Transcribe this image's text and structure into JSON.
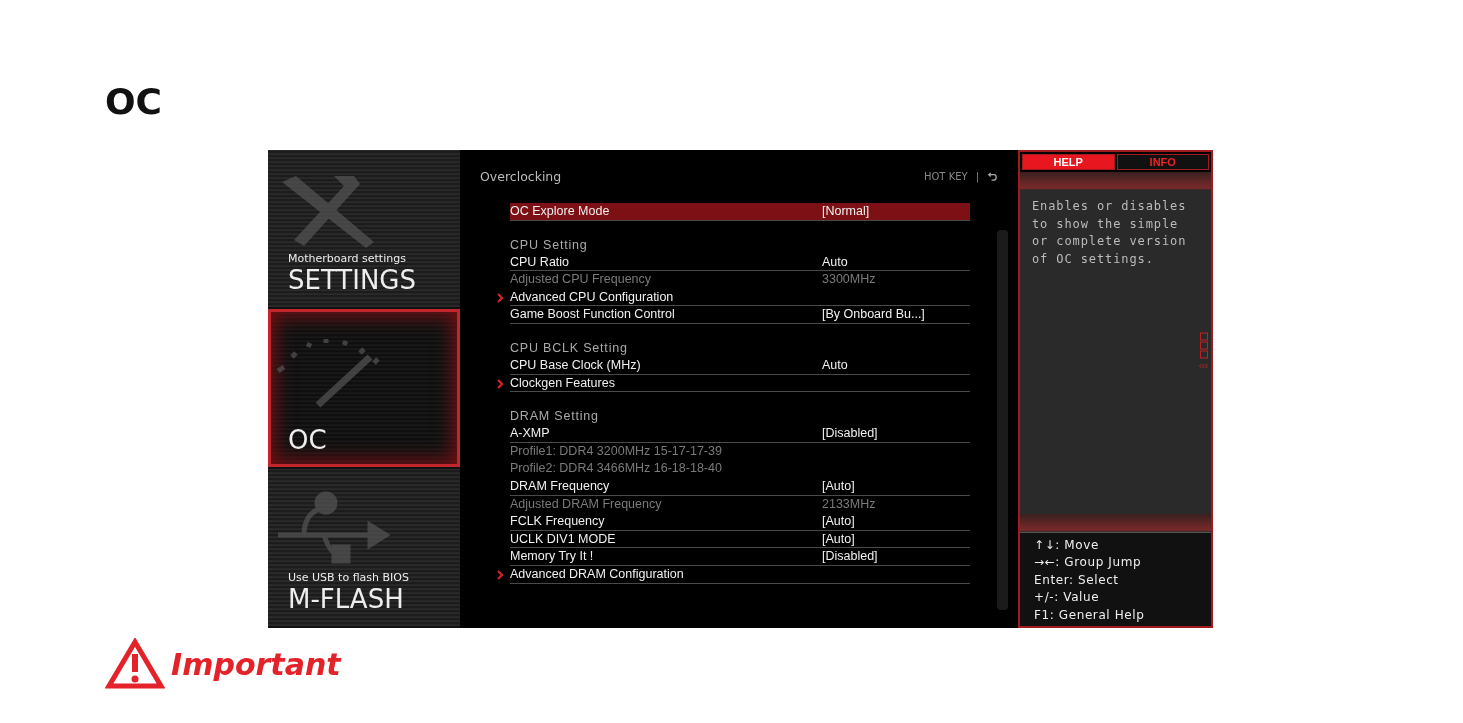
{
  "page_title": "OC",
  "bios": {
    "sidebar": [
      {
        "subtitle": "Motherboard settings",
        "title": "SETTINGS",
        "selected": false
      },
      {
        "title": "OC",
        "selected": true
      },
      {
        "subtitle": "Use USB to flash BIOS",
        "title": "M-FLASH",
        "selected": false
      }
    ],
    "header": {
      "title": "Overclocking",
      "hotkey": "HOT KEY",
      "separator": "|"
    },
    "items": [
      {
        "kind": "option",
        "label": "OC Explore Mode",
        "value": "[Normal]",
        "selected": true
      },
      {
        "kind": "header",
        "label": "CPU Setting"
      },
      {
        "kind": "option",
        "label": "CPU Ratio",
        "value": "Auto",
        "selected": false
      },
      {
        "kind": "readonly",
        "label": "Adjusted CPU Frequency",
        "value": "3300MHz",
        "selected": false
      },
      {
        "kind": "submenu",
        "label": "Advanced CPU Configuration",
        "selected": false
      },
      {
        "kind": "option",
        "label": "Game Boost Function Control",
        "value": "[By Onboard Bu...]",
        "selected": false
      },
      {
        "kind": "header",
        "label": "CPU BCLK Setting"
      },
      {
        "kind": "option",
        "label": "CPU Base Clock (MHz)",
        "value": "Auto",
        "selected": false
      },
      {
        "kind": "submenu",
        "label": "Clockgen Features",
        "selected": false
      },
      {
        "kind": "header",
        "label": "DRAM Setting"
      },
      {
        "kind": "option",
        "label": "A-XMP",
        "value": "[Disabled]",
        "selected": false
      },
      {
        "kind": "readonly",
        "label": "Profile1: DDR4 3200MHz 15-17-17-39",
        "selected": false
      },
      {
        "kind": "readonly",
        "label": "Profile2: DDR4 3466MHz 16-18-18-40",
        "selected": false
      },
      {
        "kind": "option",
        "label": "DRAM Frequency",
        "value": "[Auto]",
        "selected": false
      },
      {
        "kind": "readonly",
        "label": "Adjusted DRAM Frequency",
        "value": "2133MHz",
        "selected": false
      },
      {
        "kind": "option",
        "label": "FCLK Frequency",
        "value": "[Auto]",
        "selected": false
      },
      {
        "kind": "option",
        "label": "UCLK DIV1 MODE",
        "value": "[Auto]",
        "selected": false
      },
      {
        "kind": "option",
        "label": "Memory Try It !",
        "value": "[Disabled]",
        "selected": false
      },
      {
        "kind": "submenu",
        "label": "Advanced DRAM Configuration",
        "selected": false
      }
    ],
    "tabs": [
      {
        "label": "HELP",
        "selected": true
      },
      {
        "label": "INFO",
        "selected": false
      }
    ],
    "help_text": "Enables or disables to show the simple or complete version of OC settings.",
    "keys": [
      "↑↓: Move",
      "→←: Group Jump",
      "Enter: Select",
      "+/-: Value",
      "F1: General Help"
    ]
  },
  "notice": {
    "title": "Important"
  }
}
